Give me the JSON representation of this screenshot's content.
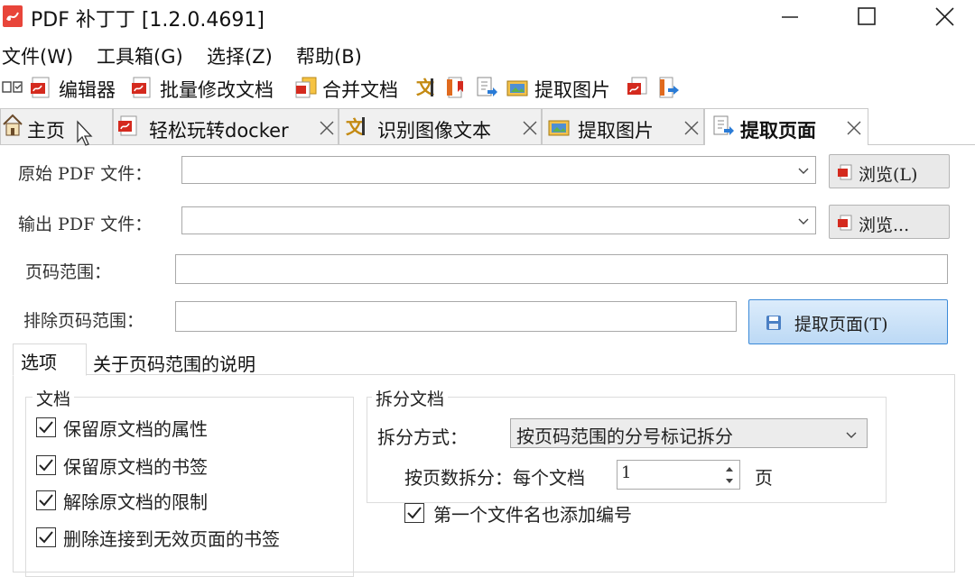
{
  "window": {
    "title": "PDF 补丁丁 [1.2.0.4691]"
  },
  "menu": [
    "文件(W)",
    "工具箱(G)",
    "选择(Z)",
    "帮助(B)"
  ],
  "toolbar": {
    "editor": "编辑器",
    "batch_modify": "批量修改文档",
    "merge": "合并文档",
    "extract_images": "提取图片"
  },
  "tabs": {
    "home": "主页",
    "docker": "轻松玩转docker",
    "ocr": "识别图像文本",
    "extract_images": "提取图片",
    "extract_pages": "提取页面"
  },
  "form": {
    "source_label": "原始 PDF 文件：",
    "source_value": "",
    "browse_source": "浏览(L)",
    "output_label": "输出 PDF 文件：",
    "output_value": "",
    "browse_output": "浏览...",
    "page_range_label": "页码范围：",
    "page_range_value": "",
    "exclude_label": "排除页码范围：",
    "exclude_value": "",
    "extract_button": "提取页面(T)"
  },
  "options_tabs": {
    "options": "选项",
    "about_range": "关于页码范围的说明"
  },
  "document_group": {
    "title": "文档",
    "items": [
      {
        "label": "保留原文档的属性",
        "checked": true
      },
      {
        "label": "保留原文档的书签",
        "checked": true
      },
      {
        "label": "解除原文档的限制",
        "checked": true
      },
      {
        "label": "删除连接到无效页面的书签",
        "checked": true
      }
    ]
  },
  "split_group": {
    "title": "拆分文档",
    "method_label": "拆分方式：",
    "method_value": "按页码范围的分号标记拆分",
    "by_pages_label": "按页数拆分：每个文档",
    "pages_value": "1",
    "pages_unit": "页",
    "number_first_label": "第一个文件名也添加编号",
    "number_first_checked": true
  },
  "colors": {
    "accent_border": "#3c8ad8",
    "pdf_red": "#d42a1e"
  }
}
